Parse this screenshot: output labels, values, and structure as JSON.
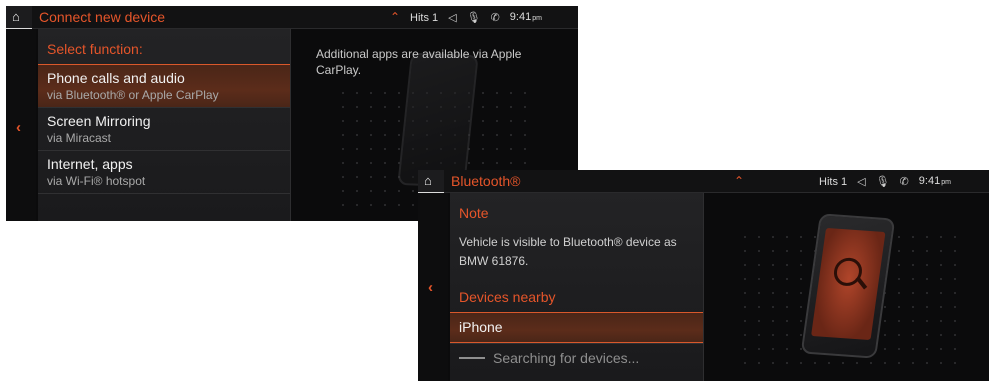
{
  "screen1": {
    "title": "Connect new device",
    "status": {
      "source": "Hits 1",
      "clock": "9:41",
      "ampm": "pm"
    },
    "panel": {
      "header": "Select function:",
      "items": [
        {
          "title": "Phone calls and audio",
          "subtitle": "via Bluetooth® or Apple CarPlay",
          "selected": true
        },
        {
          "title": "Screen Mirroring",
          "subtitle": "via Miracast",
          "selected": false
        },
        {
          "title": "Internet, apps",
          "subtitle": "via Wi-Fi® hotspot",
          "selected": false
        }
      ]
    },
    "info": "Additional apps are available via Apple CarPlay."
  },
  "screen2": {
    "title": "Bluetooth®",
    "status": {
      "source": "Hits 1",
      "clock": "9:41",
      "ampm": "pm"
    },
    "panel": {
      "note_header": "Note",
      "note_text": "Vehicle is visible to Bluetooth® device as BMW 61876.",
      "devices_header": "Devices nearby",
      "device": "iPhone",
      "searching": "Searching for devices..."
    }
  },
  "icons": {
    "home": "home-icon",
    "back": "chevron-left-icon",
    "expand": "chevron-up-icon",
    "volume": "speaker-icon",
    "mic": "microphone-icon",
    "phone": "phone-status-icon"
  },
  "colors": {
    "accent": "#e5552a",
    "background": "#0b0b0c",
    "panel": "#1e1e20"
  }
}
